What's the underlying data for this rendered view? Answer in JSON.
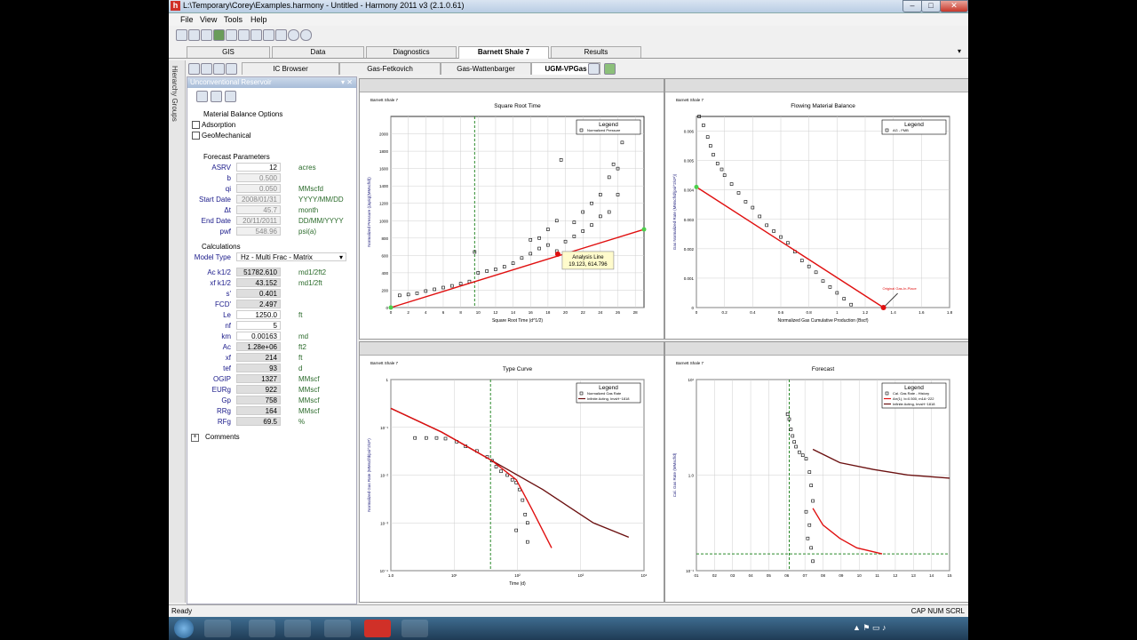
{
  "window": {
    "title": "L:\\Temporary\\Corey\\Examples.harmony - Untitled - Harmony 2011 v3 (2.1.0.61)",
    "icon": "h",
    "min": "–",
    "max": "□",
    "close": "✕"
  },
  "menu": [
    "File",
    "View",
    "Tools",
    "Help"
  ],
  "main_tabs": [
    "GIS",
    "Data",
    "Diagnostics",
    "Barnett Shale 7",
    "Results"
  ],
  "sub_tabs": [
    "IC Browser",
    "Gas-Fetkovich",
    "Gas-Wattenbarger",
    "UGM-VPGas"
  ],
  "side_strip": "Hierarchy Groups",
  "panel": {
    "title": "Unconventional Reservoir",
    "pin": "▾ ✕",
    "mb_header": "Material Balance Options",
    "mb_options": [
      "Adsorption",
      "GeoMechanical"
    ],
    "fp_header": "Forecast Parameters",
    "params": [
      {
        "label": "ASRV",
        "value": "12",
        "unit": "acres",
        "state": "edit"
      },
      {
        "label": "b",
        "value": "0.500",
        "unit": "",
        "state": "dis"
      },
      {
        "label": "qi",
        "value": "0.050",
        "unit": "MMscfd",
        "state": "dis"
      },
      {
        "label": "Start Date",
        "value": "2008/01/31",
        "unit": "YYYY/MM/DD",
        "state": "dis"
      },
      {
        "label": "Δt",
        "value": "45.7",
        "unit": "month",
        "state": "dis"
      },
      {
        "label": "End Date",
        "value": "20/11/2011",
        "unit": "DD/MM/YYYY",
        "state": "dis"
      },
      {
        "label": "pwf",
        "value": "548.96",
        "unit": "psi(a)",
        "state": "dis"
      }
    ],
    "calc_header": "Calculations",
    "model_label": "Model Type",
    "model_value": "Hz - Multi Frac - Matrix",
    "calcs": [
      {
        "label": "Ac k1/2",
        "value": "51782.610",
        "unit": "md1/2ft2",
        "state": "calc"
      },
      {
        "label": "xf k1/2",
        "value": "43.152",
        "unit": "md1/2ft",
        "state": "calc"
      },
      {
        "label": "s'",
        "value": "0.401",
        "unit": "",
        "state": "calc"
      },
      {
        "label": "FCD'",
        "value": "2.497",
        "unit": "",
        "state": "calc"
      },
      {
        "label": "Le",
        "value": "1250.0",
        "unit": "ft",
        "state": "edit"
      },
      {
        "label": "nf",
        "value": "5",
        "unit": "",
        "state": "edit"
      },
      {
        "label": "km",
        "value": "0.00163",
        "unit": "md",
        "state": "edit"
      },
      {
        "label": "Ac",
        "value": "1.28e+06",
        "unit": "ft2",
        "state": "calc"
      },
      {
        "label": "xf",
        "value": "214",
        "unit": "ft",
        "state": "calc"
      },
      {
        "label": "tef",
        "value": "93",
        "unit": "d",
        "state": "calc"
      },
      {
        "label": "OGIP",
        "value": "1327",
        "unit": "MMscf",
        "state": "calc"
      },
      {
        "label": "EURg",
        "value": "922",
        "unit": "MMscf",
        "state": "calc"
      },
      {
        "label": "Gp",
        "value": "758",
        "unit": "MMscf",
        "state": "calc"
      },
      {
        "label": "RRg",
        "value": "164",
        "unit": "MMscf",
        "state": "calc"
      },
      {
        "label": "RFg",
        "value": "69.5",
        "unit": "%",
        "state": "calc"
      }
    ],
    "comments": "Comments"
  },
  "status": {
    "left": "Ready",
    "right": "CAP  NUM  SCRL"
  },
  "chart_data": [
    {
      "type": "scatter",
      "tag": "Barnett Shale 7",
      "title": "Square Root Time",
      "xlabel": "Square Root Time (d^1/2)",
      "ylabel": "Normalized Pressure ((Δp/q)(MMscf/d))",
      "xlim": [
        0,
        29
      ],
      "ylim": [
        0,
        2200
      ],
      "xticks": [
        0,
        2,
        4,
        6,
        8,
        10,
        12,
        14,
        16,
        18,
        20,
        22,
        24,
        26,
        28
      ],
      "yticks": [
        0,
        200,
        400,
        600,
        800,
        1000,
        1200,
        1400,
        1600,
        1800,
        2000
      ],
      "legend_title": "Legend",
      "legend": [
        "Normalized Pressure"
      ],
      "vline_x": 9.6,
      "fit_line": {
        "x": [
          0,
          29
        ],
        "y": [
          0,
          900
        ]
      },
      "annotation": {
        "title": "Analysis Line",
        "text": "19.123, 614.796",
        "x": 19.123,
        "y": 614.796
      },
      "points": [
        [
          1,
          140
        ],
        [
          2,
          150
        ],
        [
          3,
          165
        ],
        [
          4,
          190
        ],
        [
          5,
          210
        ],
        [
          6,
          230
        ],
        [
          7,
          250
        ],
        [
          8,
          275
        ],
        [
          9,
          300
        ],
        [
          9.6,
          640
        ],
        [
          10,
          400
        ],
        [
          11,
          420
        ],
        [
          12,
          440
        ],
        [
          13,
          470
        ],
        [
          14,
          510
        ],
        [
          15,
          570
        ],
        [
          16,
          620
        ],
        [
          16,
          780
        ],
        [
          17,
          680
        ],
        [
          17,
          800
        ],
        [
          18,
          720
        ],
        [
          18,
          900
        ],
        [
          19,
          650
        ],
        [
          19,
          1000
        ],
        [
          19.5,
          1700
        ],
        [
          20,
          760
        ],
        [
          21,
          820
        ],
        [
          21,
          980
        ],
        [
          22,
          880
        ],
        [
          22,
          1100
        ],
        [
          23,
          950
        ],
        [
          23,
          1200
        ],
        [
          24,
          1050
        ],
        [
          24,
          1300
        ],
        [
          25,
          1100
        ],
        [
          25,
          1500
        ],
        [
          25.5,
          1650
        ],
        [
          26,
          1300
        ],
        [
          26,
          1600
        ],
        [
          26.5,
          1900
        ]
      ]
    },
    {
      "type": "scatter",
      "tag": "Barnett Shale 7",
      "title": "Flowing Material Balance",
      "xlabel": "Normalized Gas Cumulative Production (Bscf)",
      "ylabel": "Gas Normalized Rate (MMscf/d/(psi^2/cP))",
      "xlim": [
        0,
        1.8
      ],
      "ylim": [
        0,
        0.0065
      ],
      "xticks": [
        0,
        0.2,
        0.4,
        0.6,
        0.8,
        1.0,
        1.2,
        1.4,
        1.6,
        1.8
      ],
      "yticks": [
        0,
        0.001,
        0.002,
        0.003,
        0.004,
        0.005,
        0.006
      ],
      "legend_title": "Legend",
      "legend": [
        "AG - FMB"
      ],
      "fit_line": {
        "x": [
          0,
          1.33
        ],
        "y": [
          0.0041,
          0
        ]
      },
      "annotation": {
        "title": "Original Gas-In-Place",
        "text": "",
        "x": 1.33,
        "y": 0
      },
      "points": [
        [
          0.02,
          0.0065
        ],
        [
          0.05,
          0.0062
        ],
        [
          0.08,
          0.0058
        ],
        [
          0.1,
          0.0055
        ],
        [
          0.12,
          0.0052
        ],
        [
          0.15,
          0.0049
        ],
        [
          0.18,
          0.0047
        ],
        [
          0.2,
          0.0045
        ],
        [
          0.25,
          0.0042
        ],
        [
          0.3,
          0.0039
        ],
        [
          0.35,
          0.0036
        ],
        [
          0.4,
          0.0034
        ],
        [
          0.45,
          0.0031
        ],
        [
          0.5,
          0.0028
        ],
        [
          0.55,
          0.0026
        ],
        [
          0.6,
          0.0024
        ],
        [
          0.65,
          0.0022
        ],
        [
          0.7,
          0.0019
        ],
        [
          0.75,
          0.0016
        ],
        [
          0.8,
          0.0014
        ],
        [
          0.85,
          0.0012
        ],
        [
          0.9,
          0.0009
        ],
        [
          0.95,
          0.0007
        ],
        [
          1.0,
          0.0005
        ],
        [
          1.05,
          0.0003
        ],
        [
          1.1,
          0.0001
        ]
      ]
    },
    {
      "type": "scatter",
      "tag": "Barnett Shale 7",
      "title": "Type Curve",
      "xlabel": "Time (d)",
      "ylabel": "Normalized Gas Rate (MMscf/d/psi^2/cP)",
      "xlog": true,
      "ylog": true,
      "xlim": [
        1,
        100000
      ],
      "ylim": [
        0.0001,
        1
      ],
      "xticks": [
        "1.0",
        "10¹",
        "10²",
        "10³",
        "10⁴"
      ],
      "yticks": [
        "10⁻⁴",
        "10⁻³",
        "10⁻²",
        "10⁻¹",
        "1"
      ],
      "legend_title": "Legend",
      "legend": [
        "Normalized Gas Rate",
        "Infinite Acting, InvsH~1818"
      ],
      "vline_x": 93,
      "curve_red": [
        [
          1,
          0.25
        ],
        [
          10,
          0.08
        ],
        [
          100,
          0.02
        ],
        [
          300,
          0.008
        ],
        [
          600,
          0.002
        ],
        [
          1500,
          0.0003
        ]
      ],
      "curve_dark": [
        [
          1,
          0.25
        ],
        [
          10,
          0.08
        ],
        [
          100,
          0.02
        ],
        [
          1000,
          0.005
        ],
        [
          10000,
          0.001
        ],
        [
          50000,
          0.0005
        ]
      ],
      "points": [
        [
          3,
          0.06
        ],
        [
          5,
          0.06
        ],
        [
          8,
          0.06
        ],
        [
          12,
          0.058
        ],
        [
          20,
          0.05
        ],
        [
          30,
          0.04
        ],
        [
          50,
          0.032
        ],
        [
          80,
          0.024
        ],
        [
          100,
          0.02
        ],
        [
          120,
          0.015
        ],
        [
          150,
          0.012
        ],
        [
          200,
          0.01
        ],
        [
          250,
          0.008
        ],
        [
          300,
          0.007
        ],
        [
          350,
          0.005
        ],
        [
          400,
          0.003
        ],
        [
          450,
          0.0015
        ],
        [
          500,
          0.001
        ],
        [
          300,
          0.0007
        ],
        [
          500,
          0.0004
        ]
      ]
    },
    {
      "type": "scatter",
      "tag": "Barnett Shale 7",
      "title": "Forecast",
      "xlabel": "",
      "ylabel": "Cal. Gas Rate (MMscf/d)",
      "ylog": true,
      "xlim": [
        0.5,
        15.5
      ],
      "ylim": [
        0.03,
        10
      ],
      "xticks": [
        "01",
        "02",
        "03",
        "04",
        "05",
        "06",
        "07",
        "08",
        "09",
        "10",
        "11",
        "12",
        "13",
        "14",
        "15"
      ],
      "yticks": [
        "10⁻¹",
        "1.0",
        "10¹"
      ],
      "legend_title": "Legend",
      "legend": [
        "Cal. Gas Rate - History",
        "Arr(1), b=0.500, m1A~222",
        "Infinite Acting, InvsH~1818"
      ],
      "vline_x": 6,
      "hline_y": 0.05,
      "curve_red": [
        [
          7.4,
          0.2
        ],
        [
          8,
          0.12
        ],
        [
          9,
          0.08
        ],
        [
          10,
          0.06
        ],
        [
          11.5,
          0.05
        ]
      ],
      "curve_dark": [
        [
          7.4,
          1.2
        ],
        [
          9,
          0.8
        ],
        [
          11,
          0.65
        ],
        [
          13,
          0.55
        ],
        [
          15.5,
          0.5
        ]
      ],
      "points": [
        [
          5.9,
          3.5
        ],
        [
          6,
          3
        ],
        [
          6.1,
          2.2
        ],
        [
          6.2,
          1.8
        ],
        [
          6.3,
          1.5
        ],
        [
          6.4,
          1.3
        ],
        [
          6.6,
          1.1
        ],
        [
          6.8,
          1.0
        ],
        [
          7,
          0.9
        ],
        [
          7.2,
          0.6
        ],
        [
          7.3,
          0.4
        ],
        [
          7.4,
          0.25
        ],
        [
          7,
          0.18
        ],
        [
          7.2,
          0.12
        ],
        [
          7.1,
          0.08
        ],
        [
          7.3,
          0.06
        ],
        [
          7.4,
          0.04
        ]
      ]
    }
  ]
}
